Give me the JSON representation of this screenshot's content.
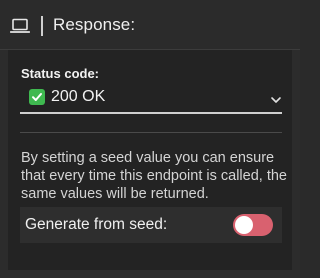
{
  "header": {
    "icon": "laptop-icon",
    "title": "Response:"
  },
  "status": {
    "label": "Status code:",
    "selected_icon": "check-icon",
    "selected_value": "200 OK"
  },
  "seed": {
    "description": "By setting a seed value you can ensure that every time this endpoint is called, the same values will be returned.",
    "toggle_label": "Generate from seed:",
    "toggle_on": false,
    "toggle_color": "#d9616f"
  }
}
